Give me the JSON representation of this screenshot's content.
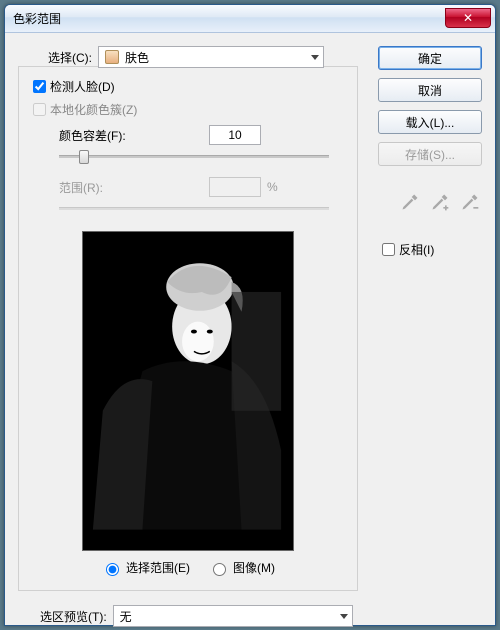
{
  "window_title": "色彩范围",
  "select_label": "选择(C):",
  "select_value": "肤色",
  "detect_faces_label": "检测人脸(D)",
  "detect_faces_checked": true,
  "localized_label": "本地化颜色簇(Z)",
  "localized_checked": false,
  "fuzziness_label": "颜色容差(F):",
  "fuzziness_value": "10",
  "range_label": "范围(R):",
  "range_value": "",
  "percent_symbol": "%",
  "radio_selection_label": "选择范围(E)",
  "radio_image_label": "图像(M)",
  "selection_preview_label": "选区预览(T):",
  "selection_preview_value": "无",
  "btn_ok": "确定",
  "btn_cancel": "取消",
  "btn_load": "载入(L)...",
  "btn_save": "存储(S)...",
  "invert_label": "反相(I)",
  "invert_checked": false,
  "close_glyph": "✕",
  "slider_thumb_left_px": "20"
}
